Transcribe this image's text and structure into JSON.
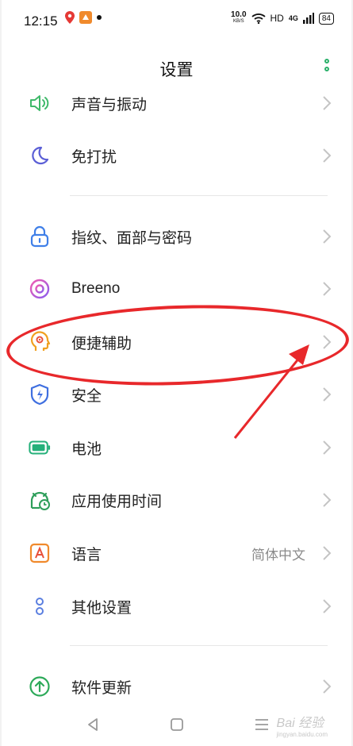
{
  "status_bar": {
    "time": "12:15",
    "net_speed": "10.0",
    "net_unit": "KB/S",
    "hd": "HD",
    "network": "4G",
    "battery": "84"
  },
  "header": {
    "title": "设置"
  },
  "items": [
    {
      "label": "声音与振动",
      "icon": "speaker-icon",
      "value": ""
    },
    {
      "label": "免打扰",
      "icon": "moon-icon",
      "value": ""
    },
    {
      "label": "指纹、面部与密码",
      "icon": "lock-icon",
      "value": ""
    },
    {
      "label": "Breeno",
      "icon": "breeno-ring-icon",
      "value": ""
    },
    {
      "label": "便捷辅助",
      "icon": "head-assist-icon",
      "value": ""
    },
    {
      "label": "安全",
      "icon": "shield-bolt-icon",
      "value": ""
    },
    {
      "label": "电池",
      "icon": "battery-icon",
      "value": ""
    },
    {
      "label": "应用使用时间",
      "icon": "app-time-icon",
      "value": ""
    },
    {
      "label": "语言",
      "icon": "language-icon",
      "value": "简体中文"
    },
    {
      "label": "其他设置",
      "icon": "more-settings-icon",
      "value": ""
    },
    {
      "label": "软件更新",
      "icon": "update-arrow-icon",
      "value": ""
    }
  ],
  "watermark": {
    "text": "Bai 经验",
    "sub": "jingyan.baidu.com"
  },
  "colors": {
    "accent_green": "#2ab06a",
    "annotation_red": "#e8282b"
  }
}
